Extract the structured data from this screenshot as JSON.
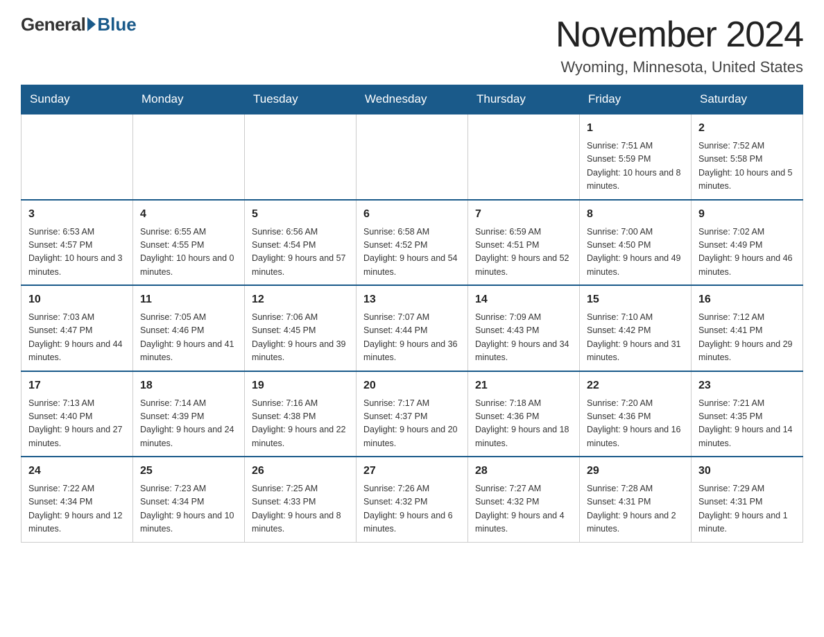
{
  "logo": {
    "general": "General",
    "blue": "Blue"
  },
  "title": "November 2024",
  "location": "Wyoming, Minnesota, United States",
  "days_header": [
    "Sunday",
    "Monday",
    "Tuesday",
    "Wednesday",
    "Thursday",
    "Friday",
    "Saturday"
  ],
  "weeks": [
    [
      {
        "day": "",
        "info": ""
      },
      {
        "day": "",
        "info": ""
      },
      {
        "day": "",
        "info": ""
      },
      {
        "day": "",
        "info": ""
      },
      {
        "day": "",
        "info": ""
      },
      {
        "day": "1",
        "info": "Sunrise: 7:51 AM\nSunset: 5:59 PM\nDaylight: 10 hours and 8 minutes."
      },
      {
        "day": "2",
        "info": "Sunrise: 7:52 AM\nSunset: 5:58 PM\nDaylight: 10 hours and 5 minutes."
      }
    ],
    [
      {
        "day": "3",
        "info": "Sunrise: 6:53 AM\nSunset: 4:57 PM\nDaylight: 10 hours and 3 minutes."
      },
      {
        "day": "4",
        "info": "Sunrise: 6:55 AM\nSunset: 4:55 PM\nDaylight: 10 hours and 0 minutes."
      },
      {
        "day": "5",
        "info": "Sunrise: 6:56 AM\nSunset: 4:54 PM\nDaylight: 9 hours and 57 minutes."
      },
      {
        "day": "6",
        "info": "Sunrise: 6:58 AM\nSunset: 4:52 PM\nDaylight: 9 hours and 54 minutes."
      },
      {
        "day": "7",
        "info": "Sunrise: 6:59 AM\nSunset: 4:51 PM\nDaylight: 9 hours and 52 minutes."
      },
      {
        "day": "8",
        "info": "Sunrise: 7:00 AM\nSunset: 4:50 PM\nDaylight: 9 hours and 49 minutes."
      },
      {
        "day": "9",
        "info": "Sunrise: 7:02 AM\nSunset: 4:49 PM\nDaylight: 9 hours and 46 minutes."
      }
    ],
    [
      {
        "day": "10",
        "info": "Sunrise: 7:03 AM\nSunset: 4:47 PM\nDaylight: 9 hours and 44 minutes."
      },
      {
        "day": "11",
        "info": "Sunrise: 7:05 AM\nSunset: 4:46 PM\nDaylight: 9 hours and 41 minutes."
      },
      {
        "day": "12",
        "info": "Sunrise: 7:06 AM\nSunset: 4:45 PM\nDaylight: 9 hours and 39 minutes."
      },
      {
        "day": "13",
        "info": "Sunrise: 7:07 AM\nSunset: 4:44 PM\nDaylight: 9 hours and 36 minutes."
      },
      {
        "day": "14",
        "info": "Sunrise: 7:09 AM\nSunset: 4:43 PM\nDaylight: 9 hours and 34 minutes."
      },
      {
        "day": "15",
        "info": "Sunrise: 7:10 AM\nSunset: 4:42 PM\nDaylight: 9 hours and 31 minutes."
      },
      {
        "day": "16",
        "info": "Sunrise: 7:12 AM\nSunset: 4:41 PM\nDaylight: 9 hours and 29 minutes."
      }
    ],
    [
      {
        "day": "17",
        "info": "Sunrise: 7:13 AM\nSunset: 4:40 PM\nDaylight: 9 hours and 27 minutes."
      },
      {
        "day": "18",
        "info": "Sunrise: 7:14 AM\nSunset: 4:39 PM\nDaylight: 9 hours and 24 minutes."
      },
      {
        "day": "19",
        "info": "Sunrise: 7:16 AM\nSunset: 4:38 PM\nDaylight: 9 hours and 22 minutes."
      },
      {
        "day": "20",
        "info": "Sunrise: 7:17 AM\nSunset: 4:37 PM\nDaylight: 9 hours and 20 minutes."
      },
      {
        "day": "21",
        "info": "Sunrise: 7:18 AM\nSunset: 4:36 PM\nDaylight: 9 hours and 18 minutes."
      },
      {
        "day": "22",
        "info": "Sunrise: 7:20 AM\nSunset: 4:36 PM\nDaylight: 9 hours and 16 minutes."
      },
      {
        "day": "23",
        "info": "Sunrise: 7:21 AM\nSunset: 4:35 PM\nDaylight: 9 hours and 14 minutes."
      }
    ],
    [
      {
        "day": "24",
        "info": "Sunrise: 7:22 AM\nSunset: 4:34 PM\nDaylight: 9 hours and 12 minutes."
      },
      {
        "day": "25",
        "info": "Sunrise: 7:23 AM\nSunset: 4:34 PM\nDaylight: 9 hours and 10 minutes."
      },
      {
        "day": "26",
        "info": "Sunrise: 7:25 AM\nSunset: 4:33 PM\nDaylight: 9 hours and 8 minutes."
      },
      {
        "day": "27",
        "info": "Sunrise: 7:26 AM\nSunset: 4:32 PM\nDaylight: 9 hours and 6 minutes."
      },
      {
        "day": "28",
        "info": "Sunrise: 7:27 AM\nSunset: 4:32 PM\nDaylight: 9 hours and 4 minutes."
      },
      {
        "day": "29",
        "info": "Sunrise: 7:28 AM\nSunset: 4:31 PM\nDaylight: 9 hours and 2 minutes."
      },
      {
        "day": "30",
        "info": "Sunrise: 7:29 AM\nSunset: 4:31 PM\nDaylight: 9 hours and 1 minute."
      }
    ]
  ]
}
